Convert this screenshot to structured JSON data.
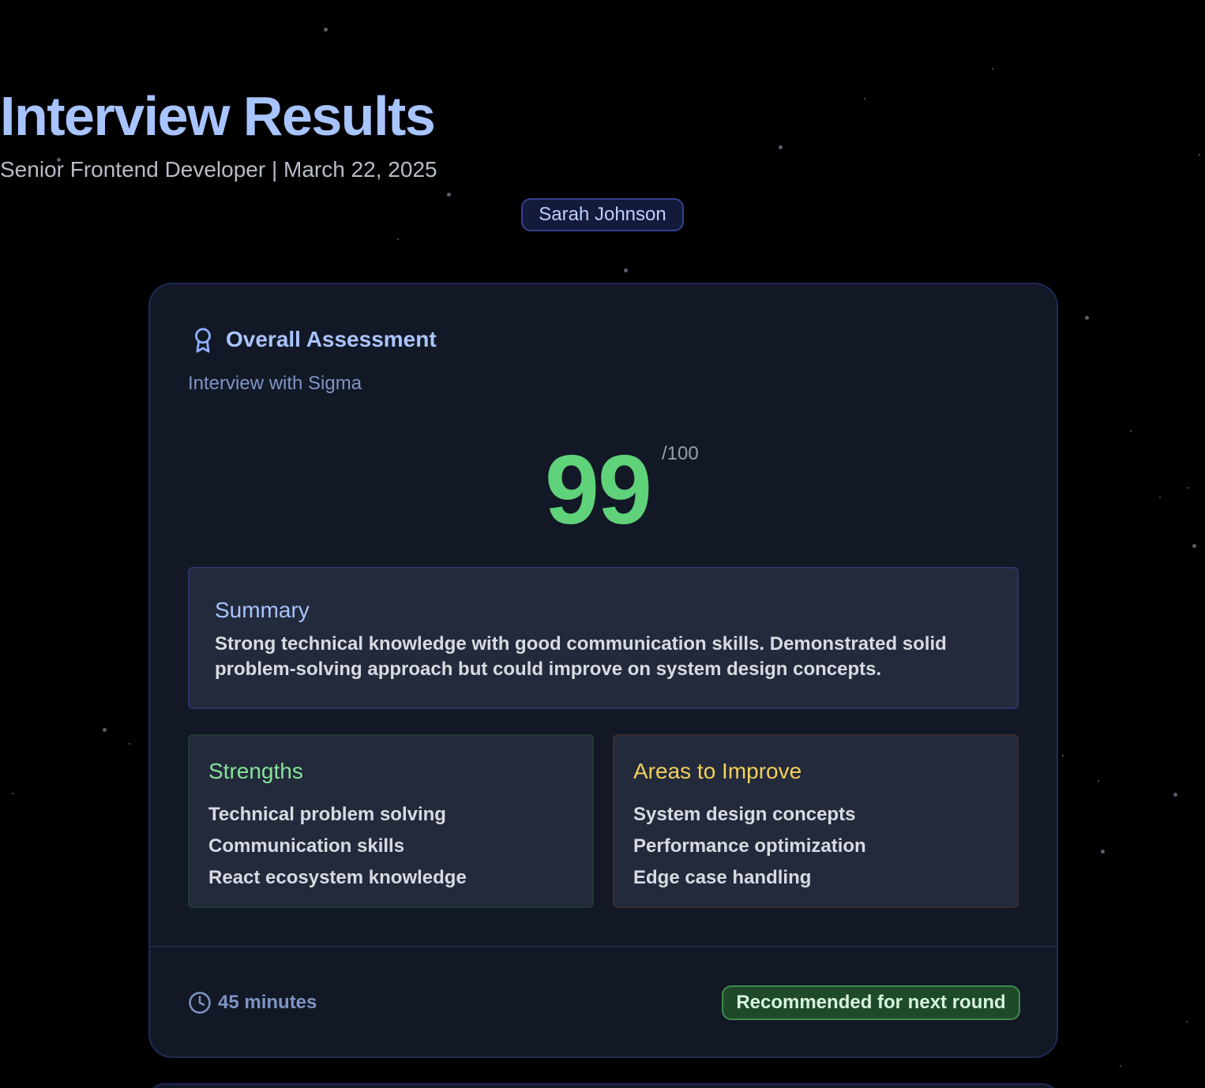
{
  "header": {
    "title": "Interview Results",
    "subtitle": "Senior Frontend Developer | March 22, 2025",
    "candidate_name": "Sarah Johnson"
  },
  "assessment": {
    "title": "Overall Assessment",
    "subtitle": "Interview with Sigma",
    "icon": "award-icon",
    "score": "99",
    "score_max": "/100",
    "summary": {
      "title": "Summary",
      "text": "Strong technical knowledge with good communication skills. Demonstrated solid problem-solving approach but could improve on system design concepts."
    },
    "strengths": {
      "title": "Strengths",
      "items": [
        "Technical problem solving",
        "Communication skills",
        "React ecosystem knowledge"
      ]
    },
    "improvements": {
      "title": "Areas to Improve",
      "items": [
        "System design concepts",
        "Performance optimization",
        "Edge case handling"
      ]
    },
    "footer": {
      "duration": "45 minutes",
      "duration_icon": "clock-icon",
      "recommendation": "Recommended for next round"
    }
  },
  "colors": {
    "background": "#000000",
    "title": "#a8c4ff",
    "score": "#5fd27a",
    "strengths": "#86e29a",
    "improve": "#f3cf5b",
    "recommendation_bg": "#1e4a2a"
  }
}
